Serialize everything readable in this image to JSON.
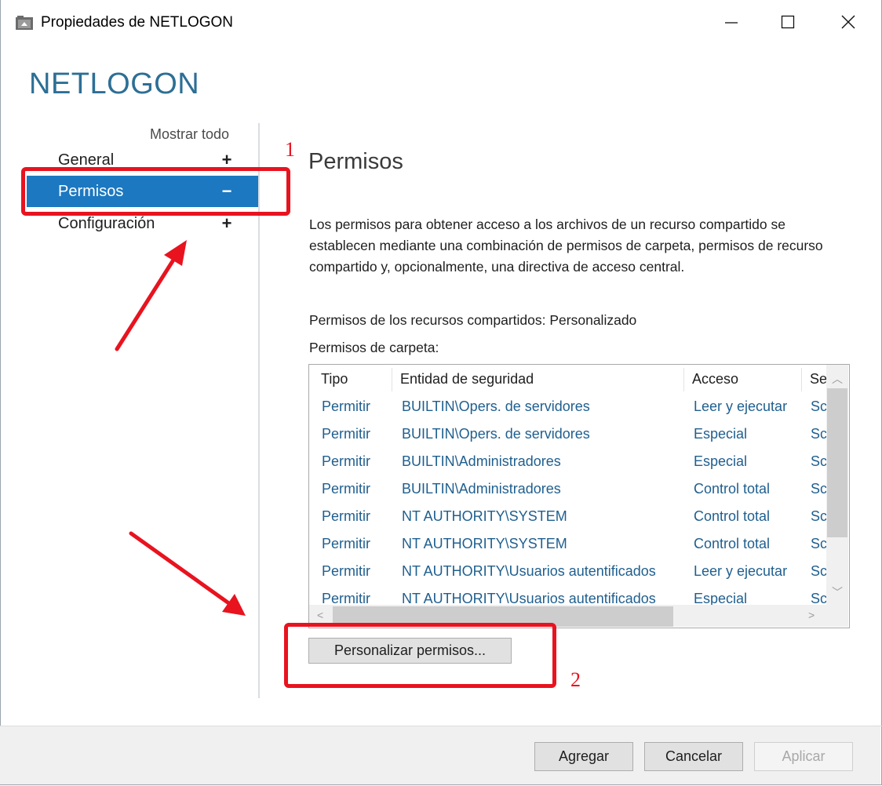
{
  "window": {
    "title": "Propiedades de NETLOGON",
    "heading": "NETLOGON"
  },
  "sidebar": {
    "show_all": "Mostrar todo",
    "items": [
      {
        "label": "General",
        "sign": "+"
      },
      {
        "label": "Permisos",
        "sign": "−",
        "selected": true
      },
      {
        "label": "Configuración",
        "sign": "+"
      }
    ]
  },
  "section": {
    "title": "Permisos",
    "description": "Los permisos para obtener acceso a los archivos de un recurso compartido se establecen mediante una combinación de permisos de carpeta, permisos de recurso compartido y, opcionalmente, una directiva de acceso central.",
    "share_perms_label": "Permisos de los recursos compartidos:",
    "share_perms_value": "Personalizado",
    "folder_perms_label": "Permisos de carpeta:"
  },
  "table": {
    "columns": [
      "Tipo",
      "Entidad de seguridad",
      "Acceso",
      "Se"
    ],
    "rows": [
      [
        "Permitir",
        "BUILTIN\\Opers. de servidores",
        "Leer y ejecutar",
        "Sc"
      ],
      [
        "Permitir",
        "BUILTIN\\Opers. de servidores",
        "Especial",
        "Sc"
      ],
      [
        "Permitir",
        "BUILTIN\\Administradores",
        "Especial",
        "Sc"
      ],
      [
        "Permitir",
        "BUILTIN\\Administradores",
        "Control total",
        "Sc"
      ],
      [
        "Permitir",
        "NT AUTHORITY\\SYSTEM",
        "Control total",
        "Sc"
      ],
      [
        "Permitir",
        "NT AUTHORITY\\SYSTEM",
        "Control total",
        "Sc"
      ],
      [
        "Permitir",
        "NT AUTHORITY\\Usuarios autentificados",
        "Leer y ejecutar",
        "Sc"
      ],
      [
        "Permitir",
        "NT AUTHORITY\\Usuarios autentificados",
        "Especial",
        "Sc"
      ]
    ]
  },
  "buttons": {
    "customize": "Personalizar permisos...",
    "add": "Agregar",
    "cancel": "Cancelar",
    "apply": "Aplicar"
  },
  "annotations": {
    "marker_1": "1",
    "marker_2": "2",
    "color": "#e8131f"
  },
  "colors": {
    "accent": "#1c78c0",
    "heading": "#2d6f95"
  }
}
